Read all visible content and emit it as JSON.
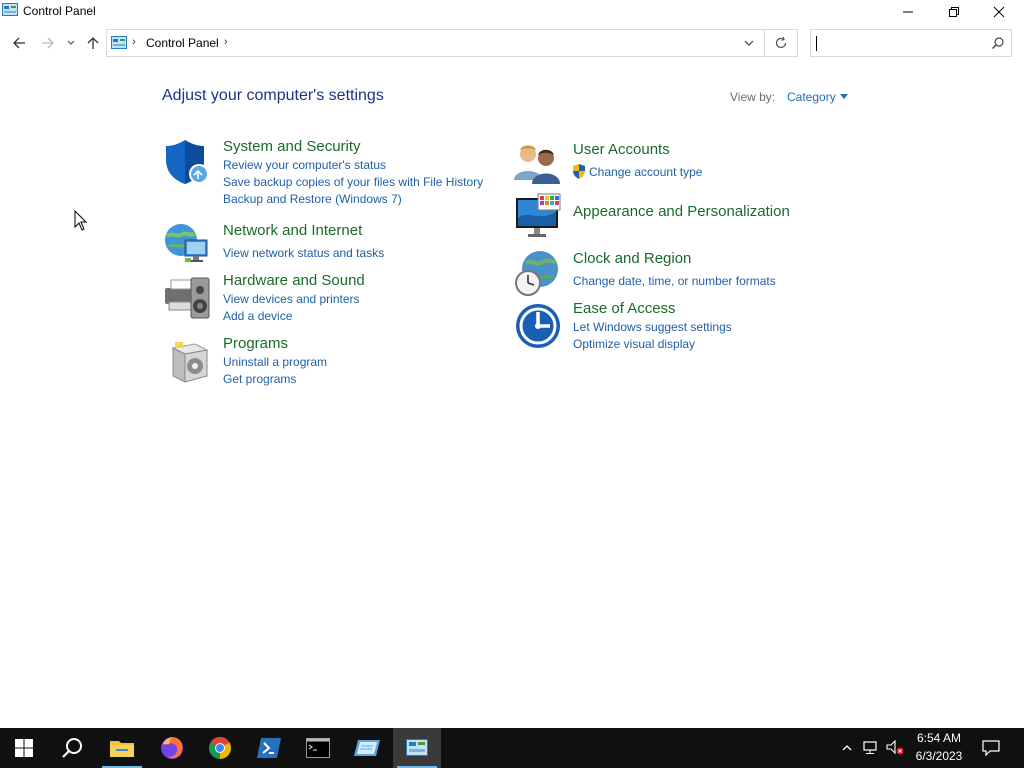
{
  "window": {
    "title": "Control Panel",
    "buttons": {
      "minimize_icon": "minimize-icon",
      "maximize_icon": "restore-icon",
      "close_icon": "close-icon"
    }
  },
  "address_bar": {
    "path": "Control Panel",
    "separator": "›",
    "search_placeholder": ""
  },
  "content": {
    "heading": "Adjust your computer's settings",
    "view_by_label": "View by:",
    "view_by_value": "Category",
    "left_categories": [
      {
        "title": "System and Security",
        "icon": "shield-icon",
        "links": [
          "Review your computer's status",
          "Save backup copies of your files with File History",
          "Backup and Restore (Windows 7)"
        ]
      },
      {
        "title": "Network and Internet",
        "icon": "network-globe-icon",
        "links": [
          "View network status and tasks"
        ]
      },
      {
        "title": "Hardware and Sound",
        "icon": "printer-speaker-icon",
        "links": [
          "View devices and printers",
          "Add a device"
        ]
      },
      {
        "title": "Programs",
        "icon": "programs-box-icon",
        "links": [
          "Uninstall a program",
          "Get programs"
        ]
      }
    ],
    "right_categories": [
      {
        "title": "User Accounts",
        "icon": "users-icon",
        "links": [
          "Change account type"
        ]
      },
      {
        "title": "Appearance and Personalization",
        "icon": "monitor-palette-icon",
        "links": []
      },
      {
        "title": "Clock and Region",
        "icon": "clock-globe-icon",
        "links": [
          "Change date, time, or number formats"
        ]
      },
      {
        "title": "Ease of Access",
        "icon": "ease-of-access-icon",
        "links": [
          "Let Windows suggest settings",
          "Optimize visual display"
        ]
      }
    ]
  },
  "taskbar": {
    "items": [
      "start-icon",
      "search-icon",
      "file-explorer-icon",
      "firefox-icon",
      "chrome-icon",
      "powershell-icon",
      "command-prompt-icon",
      "notepad-icon",
      "control-panel-icon"
    ],
    "active_item": "control-panel-icon",
    "time": "6:54 AM",
    "date": "6/3/2023"
  },
  "colors": {
    "heading": "#1e3287",
    "category_title": "#1a6b2a",
    "link": "#1f5fa8",
    "taskbar": "#101010"
  }
}
